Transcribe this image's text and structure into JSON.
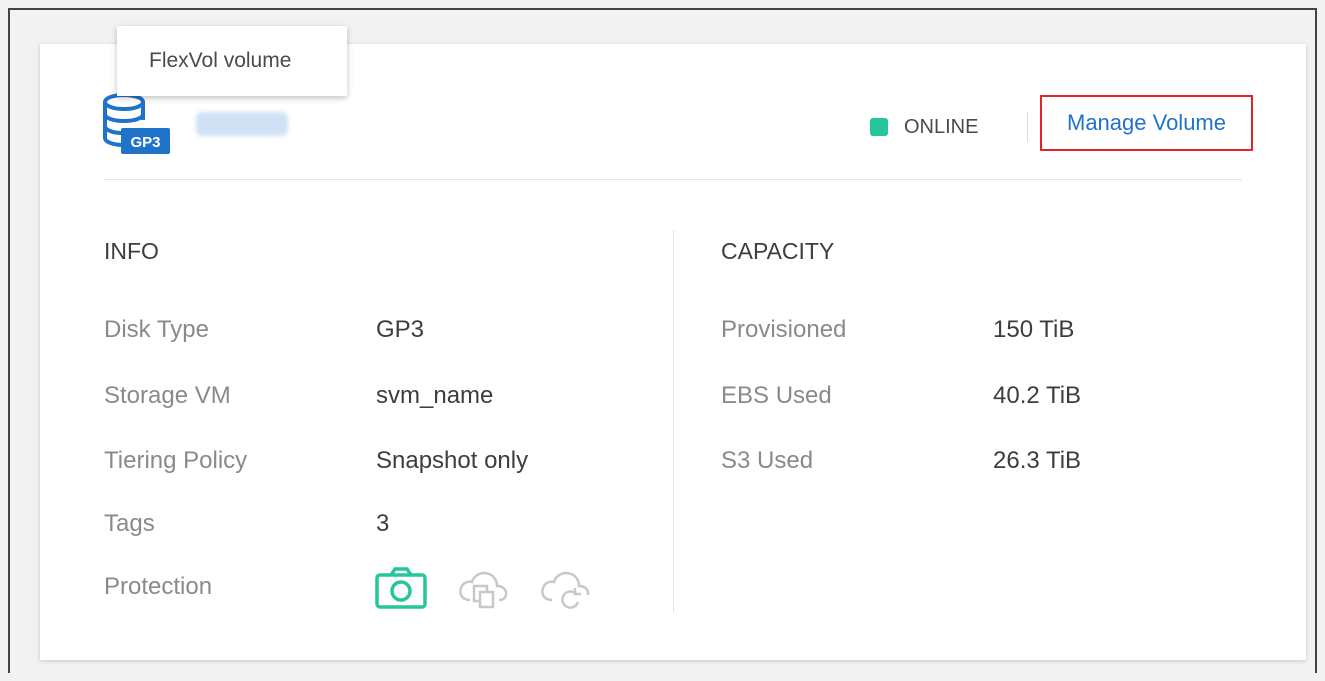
{
  "tooltip": {
    "text": "FlexVol volume"
  },
  "volume": {
    "icon_badge": "GP3",
    "icon": "database-icon"
  },
  "status": {
    "label": "ONLINE",
    "color": "#26c59a"
  },
  "actions": {
    "manage_label": "Manage Volume",
    "link_color": "#1f73c8",
    "highlight_color": "#e0262b"
  },
  "info": {
    "title": "INFO",
    "rows": [
      {
        "label": "Disk Type",
        "value": "GP3"
      },
      {
        "label": "Storage VM",
        "value": "svm_name"
      },
      {
        "label": "Tiering Policy",
        "value": "Snapshot only"
      },
      {
        "label": "Tags",
        "value": "3"
      },
      {
        "label": "Protection"
      }
    ],
    "protection_icons": [
      {
        "name": "snapshot-camera-icon",
        "active": true,
        "color": "#26c59a"
      },
      {
        "name": "replication-icon",
        "active": false,
        "color": "#c8c8c8"
      },
      {
        "name": "cloud-backup-icon",
        "active": false,
        "color": "#c8c8c8"
      }
    ]
  },
  "capacity": {
    "title": "CAPACITY",
    "rows": [
      {
        "label": "Provisioned",
        "value": "150 TiB"
      },
      {
        "label": "EBS Used",
        "value": "40.2 TiB"
      },
      {
        "label": "S3 Used",
        "value": "26.3 TiB"
      }
    ]
  }
}
